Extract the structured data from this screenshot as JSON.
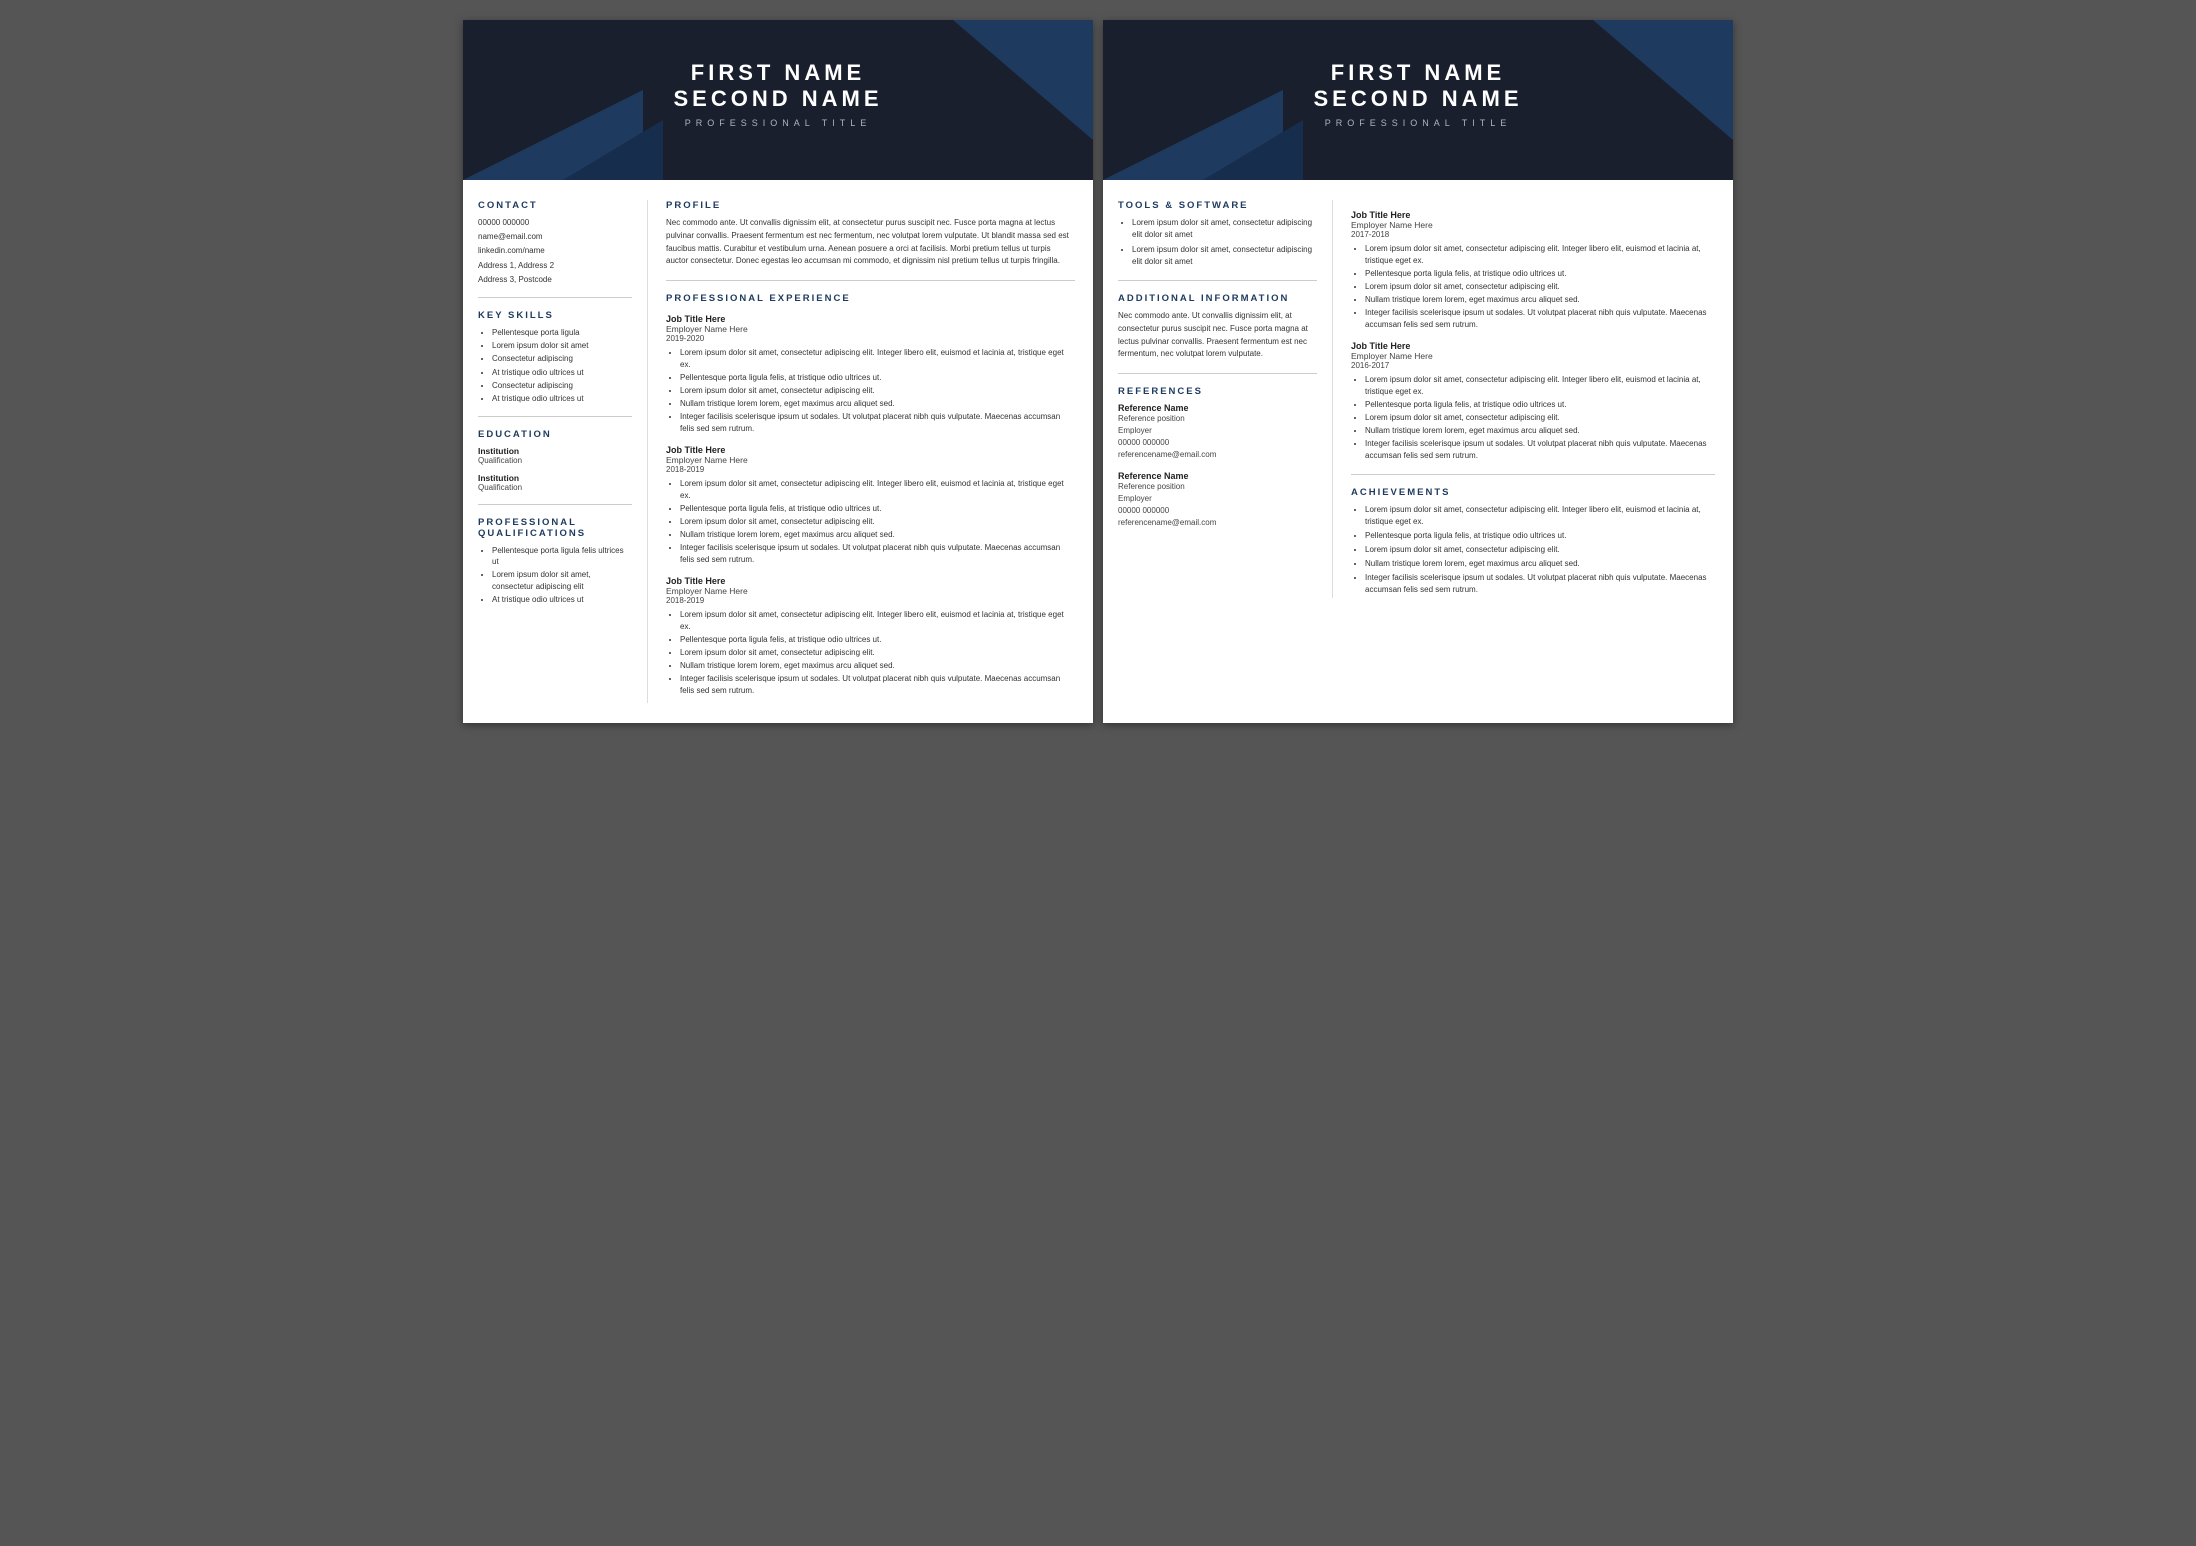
{
  "page1": {
    "header": {
      "firstName": "FIRST NAME",
      "secondName": "SECOND NAME",
      "title": "PROFESSIONAL TITLE"
    },
    "sidebar": {
      "contactTitle": "CONTACT",
      "phone": "00000 000000",
      "email": "name@email.com",
      "linkedin": "linkedin.com/name",
      "address": "Address 1, Address 2",
      "postcode": "Address 3, Postcode",
      "keySkillsTitle": "KEY SKILLS",
      "skills": [
        "Pellentesque porta ligula",
        "Lorem ipsum dolor sit amet",
        "Consectetur adipiscing",
        "At tristique odio ultrices ut",
        "Consectetur adipiscing",
        "At tristique odio ultrices ut"
      ],
      "educationTitle": "EDUCATION",
      "education": [
        {
          "institution": "Institution",
          "qualification": "Qualification"
        },
        {
          "institution": "Institution",
          "qualification": "Qualification"
        }
      ],
      "qualTitle": "PROFESSIONAL QUALIFICATIONS",
      "qualifications": [
        "Pellentesque porta ligula felis ultrices ut",
        "Lorem ipsum dolor sit amet, consectetur adipiscing elit",
        "At tristique odio ultrices ut"
      ]
    },
    "main": {
      "profileTitle": "PROFILE",
      "profileText": "Nec commodo ante. Ut convallis dignissim elit, at consectetur purus suscipit nec. Fusce porta magna at lectus pulvinar convallis. Praesent fermentum est nec fermentum, nec volutpat lorem vulputate. Ut blandit massa sed est faucibus mattis. Curabitur et vestibulum urna. Aenean posuere a orci at facilisis. Morbi pretium tellus ut turpis auctor consectetur. Donec egestas leo accumsan mi commodo, et dignissim nisl pretium tellus ut turpis fringilla.",
      "expTitle": "PROFESSIONAL EXPERIENCE",
      "jobs": [
        {
          "jobTitle": "Job Title Here",
          "employer": "Employer Name Here",
          "dates": "2019-2020",
          "bullets": [
            "Lorem ipsum dolor sit amet, consectetur adipiscing elit. Integer libero elit, euismod et lacinia at, tristique eget ex.",
            "Pellentesque porta ligula felis, at tristique odio ultrices ut.",
            "Lorem ipsum dolor sit amet, consectetur adipiscing elit.",
            "Nullam tristique lorem lorem, eget maximus arcu aliquet sed.",
            "Integer facilisis scelerisque ipsum ut sodales. Ut volutpat placerat nibh quis vulputate. Maecenas accumsan felis sed sem rutrum."
          ]
        },
        {
          "jobTitle": "Job Title Here",
          "employer": "Employer Name Here",
          "dates": "2018-2019",
          "bullets": [
            "Lorem ipsum dolor sit amet, consectetur adipiscing elit. Integer libero elit, euismod et lacinia at, tristique eget ex.",
            "Pellentesque porta ligula felis, at tristique odio ultrices ut.",
            "Lorem ipsum dolor sit amet, consectetur adipiscing elit.",
            "Nullam tristique lorem lorem, eget maximus arcu aliquet sed.",
            "Integer facilisis scelerisque ipsum ut sodales. Ut volutpat placerat nibh quis vulputate. Maecenas accumsan felis sed sem rutrum."
          ]
        },
        {
          "jobTitle": "Job Title Here",
          "employer": "Employer Name Here",
          "dates": "2018-2019",
          "bullets": [
            "Lorem ipsum dolor sit amet, consectetur adipiscing elit. Integer libero elit, euismod et lacinia at, tristique eget ex.",
            "Pellentesque porta ligula felis, at tristique odio ultrices ut.",
            "Lorem ipsum dolor sit amet, consectetur adipiscing elit.",
            "Nullam tristique lorem lorem, eget maximus arcu aliquet sed.",
            "Integer facilisis scelerisque ipsum ut sodales. Ut volutpat placerat nibh quis vulputate. Maecenas accumsan felis sed sem rutrum."
          ]
        }
      ]
    }
  },
  "page2": {
    "header": {
      "firstName": "FIRST NAME",
      "secondName": "SECOND NAME",
      "title": "PROFESSIONAL TITLE"
    },
    "left": {
      "toolsTitle": "TOOLS & SOFTWARE",
      "tools": [
        "Lorem ipsum dolor sit amet, consectetur adipiscing elit dolor sit amet",
        "Lorem ipsum dolor sit amet, consectetur adipiscing elit dolor sit amet"
      ],
      "additionalTitle": "ADDITIONAL INFORMATION",
      "additionalText": "Nec commodo ante. Ut convallis dignissim elit, at consectetur purus suscipit nec. Fusce porta magna at lectus pulvinar convallis. Praesent fermentum est nec fermentum, nec volutpat lorem vulputate.",
      "referencesTitle": "REFERENCES",
      "references": [
        {
          "name": "Reference Name",
          "position": "Reference position",
          "employer": "Employer",
          "phone": "00000 000000",
          "email": "referencename@email.com"
        },
        {
          "name": "Reference Name",
          "position": "Reference position",
          "employer": "Employer",
          "phone": "00000 000000",
          "email": "referencename@email.com"
        }
      ]
    },
    "right": {
      "jobs": [
        {
          "jobTitle": "Job Title Here",
          "employer": "Employer Name Here",
          "dates": "2017-2018",
          "bullets": [
            "Lorem ipsum dolor sit amet, consectetur adipiscing elit. Integer libero elit, euismod et lacinia at, tristique eget ex.",
            "Pellentesque porta ligula felis, at tristique odio ultrices ut.",
            "Lorem ipsum dolor sit amet, consectetur adipiscing elit.",
            "Nullam tristique lorem lorem, eget maximus arcu aliquet sed.",
            "Integer facilisis scelerisque ipsum ut sodales. Ut volutpat placerat nibh quis vulputate. Maecenas accumsan felis sed sem rutrum."
          ]
        },
        {
          "jobTitle": "Job Title Here",
          "employer": "Employer Name Here",
          "dates": "2016-2017",
          "bullets": [
            "Lorem ipsum dolor sit amet, consectetur adipiscing elit. Integer libero elit, euismod et lacinia at, tristique eget ex.",
            "Pellentesque porta ligula felis, at tristique odio ultrices ut.",
            "Lorem ipsum dolor sit amet, consectetur adipiscing elit.",
            "Nullam tristique lorem lorem, eget maximus arcu aliquet sed.",
            "Integer facilisis scelerisque ipsum ut sodales. Ut volutpat placerat nibh quis vulputate. Maecenas accumsan felis sed sem rutrum."
          ]
        }
      ],
      "achievementsTitle": "ACHIEVEMENTS",
      "achievementBullets": [
        "Lorem ipsum dolor sit amet, consectetur adipiscing elit. Integer libero elit, euismod et lacinia at, tristique eget ex.",
        "Pellentesque porta ligula felis, at tristique odio ultrices ut.",
        "Lorem ipsum dolor sit amet, consectetur adipiscing elit.",
        "Nullam tristique lorem lorem, eget maximus arcu aliquet sed.",
        "Integer facilisis scelerisque ipsum ut sodales. Ut volutpat placerat nibh quis vulputate. Maecenas accumsan felis sed sem rutrum."
      ]
    }
  }
}
